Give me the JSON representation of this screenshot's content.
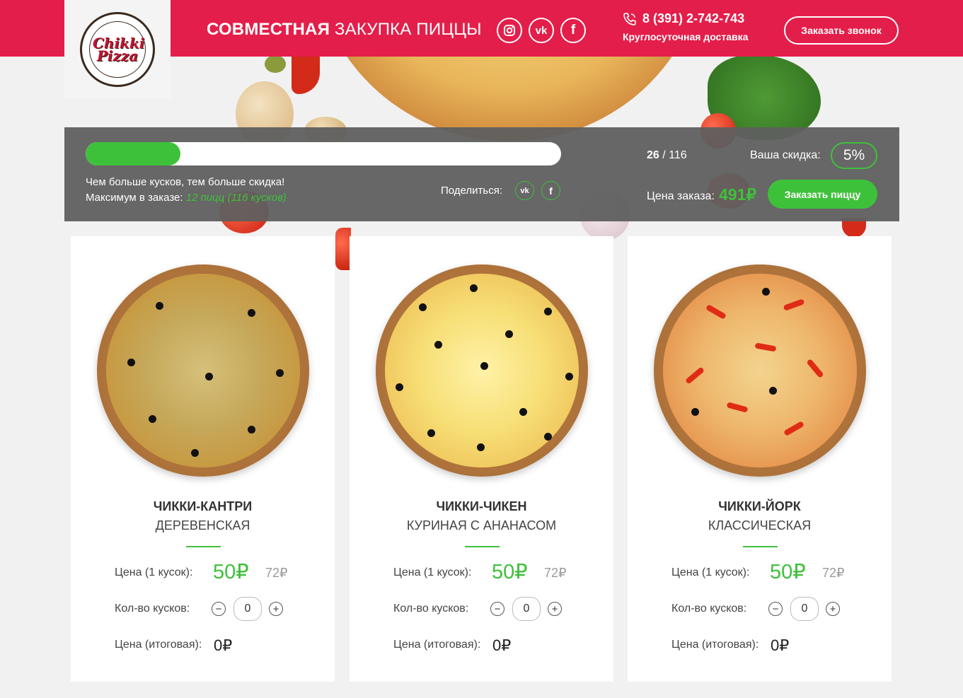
{
  "header": {
    "title_bold": "СОВМЕСТНАЯ",
    "title_rest": "ЗАКУПКА ПИЦЦЫ",
    "logo_text": "Chikki Pizza",
    "phone": "8 (391) 2-742-743",
    "phone_sub": "Круглосуточная доставка",
    "callback_button": "Заказать звонок",
    "socials": [
      {
        "name": "instagram",
        "glyph": "◎"
      },
      {
        "name": "vk",
        "glyph": "vk"
      },
      {
        "name": "facebook",
        "glyph": "f"
      }
    ]
  },
  "panel": {
    "progress": 0.224,
    "progress_fraction": 0.2,
    "hint_line1": "Чем больше кусков, тем больше скидка!",
    "hint_max_label": "Максимум в заказе:",
    "hint_max_value": "12 пицц (116 кусков)",
    "share_label": "Поделиться:",
    "count_current": "26",
    "count_total": " / 116",
    "discount_label": "Ваша скидка:",
    "discount_value": "5%",
    "order_label": "Цена заказа:",
    "order_value": "491₽",
    "order_button": "Заказать пиццу"
  },
  "labels": {
    "price_per_piece": "Цена (1 кусок):",
    "pieces": "Кол-во кусков:",
    "total": "Цена (итоговая):"
  },
  "pizzas": [
    {
      "name": "ЧИККИ-КАНТРИ",
      "subtitle": "ДЕРЕВЕНСКАЯ",
      "price": "50₽",
      "old_price": "72₽",
      "qty": "0",
      "total": "0₽"
    },
    {
      "name": "ЧИККИ-ЧИКЕН",
      "subtitle": "КУРИНАЯ С АНАНАСОМ",
      "price": "50₽",
      "old_price": "72₽",
      "qty": "0",
      "total": "0₽"
    },
    {
      "name": "ЧИККИ-ЙОРК",
      "subtitle": "КЛАССИЧЕСКАЯ",
      "price": "50₽",
      "old_price": "72₽",
      "qty": "0",
      "total": "0₽"
    }
  ],
  "colors": {
    "brand": "#e41e4a",
    "accent": "#3ec13a"
  }
}
